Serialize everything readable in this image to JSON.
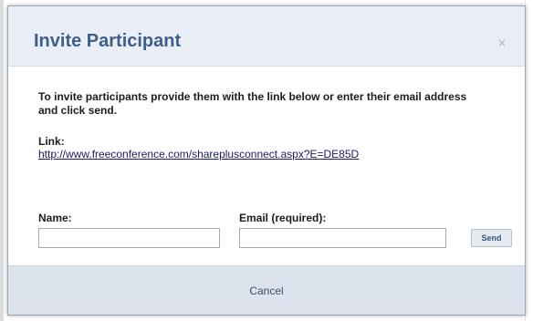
{
  "dialog": {
    "title": "Invite Participant",
    "close_glyph": "×",
    "instructions": "To invite participants provide them with the link below or enter their email address and click send.",
    "link_label": "Link:",
    "link_url": "http://www.freeconference.com/shareplusconnect.aspx?E=DE85D",
    "name_label": "Name:",
    "name_value": "",
    "email_label": "Email (required):",
    "email_value": "",
    "send_label": "Send",
    "cancel_label": "Cancel"
  },
  "colors": {
    "title": "#3f5f8a",
    "header_bg": "#eaeef6",
    "footer_bg": "#dde3ed",
    "link": "#1a1a66",
    "send_bg": "#e6eaf1"
  },
  "icons": {
    "close": "close-icon"
  }
}
